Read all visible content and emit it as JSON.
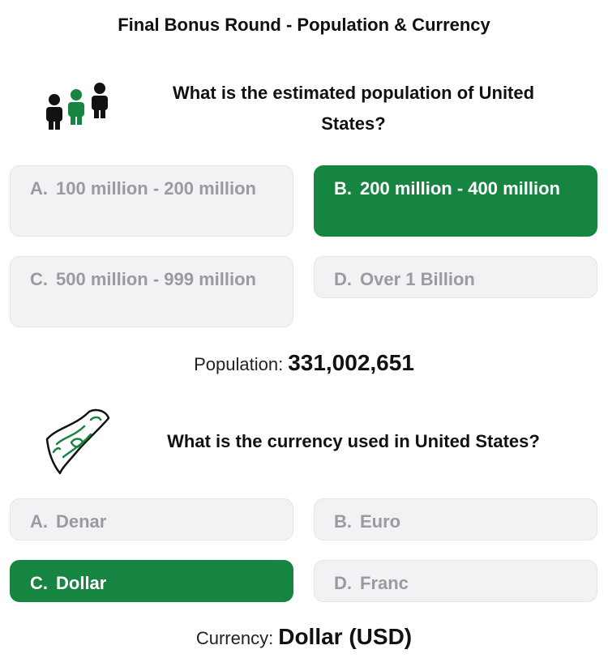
{
  "header": {
    "title": "Final Bonus Round - Population & Currency"
  },
  "population_question": {
    "icon": "people-group-icon",
    "text": "What is the estimated population of United States?",
    "options": [
      {
        "letter": "A.",
        "label": "100 million - 200 million",
        "selected": false
      },
      {
        "letter": "B.",
        "label": "200 million - 400 million",
        "selected": true
      },
      {
        "letter": "C.",
        "label": "500 million - 999 million",
        "selected": false
      },
      {
        "letter": "D.",
        "label": "Over 1 Billion",
        "selected": false
      }
    ],
    "answer_label": "Population:",
    "answer_value": "331,002,651"
  },
  "currency_question": {
    "icon": "banknote-icon",
    "text": "What is the currency used in United States?",
    "options": [
      {
        "letter": "A.",
        "label": "Denar",
        "selected": false
      },
      {
        "letter": "B.",
        "label": "Euro",
        "selected": false
      },
      {
        "letter": "C.",
        "label": "Dollar",
        "selected": true
      },
      {
        "letter": "D.",
        "label": "Franc",
        "selected": false
      }
    ],
    "answer_label": "Currency:",
    "answer_value": "Dollar (USD)"
  },
  "colors": {
    "selected": "#168542",
    "unselected_bg": "#f1f2f4",
    "unselected_text": "#9a9aa0"
  }
}
